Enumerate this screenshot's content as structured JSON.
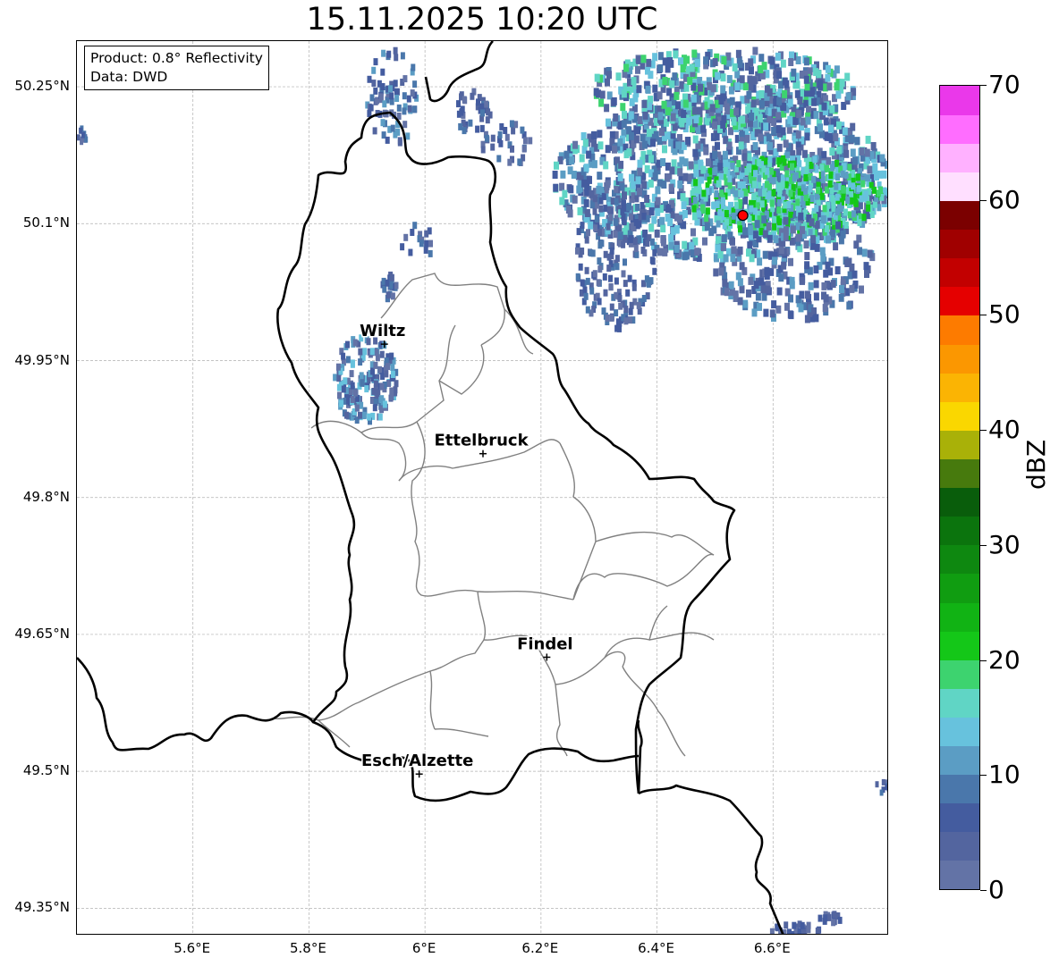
{
  "title": "15.11.2025 10:20 UTC",
  "info": {
    "product": "Product: 0.8° Reflectivity",
    "data_source": "Data: DWD"
  },
  "axes": {
    "lon_range": [
      5.4,
      6.8
    ],
    "lat_range": [
      49.32,
      50.3
    ],
    "x_ticks": [
      {
        "value": 5.6,
        "label": "5.6°E"
      },
      {
        "value": 5.8,
        "label": "5.8°E"
      },
      {
        "value": 6.0,
        "label": "6°E"
      },
      {
        "value": 6.2,
        "label": "6.2°E"
      },
      {
        "value": 6.4,
        "label": "6.4°E"
      },
      {
        "value": 6.6,
        "label": "6.6°E"
      }
    ],
    "y_ticks": [
      {
        "value": 50.25,
        "label": "50.25°N"
      },
      {
        "value": 50.1,
        "label": "50.1°N"
      },
      {
        "value": 49.95,
        "label": "49.95°N"
      },
      {
        "value": 49.8,
        "label": "49.8°N"
      },
      {
        "value": 49.65,
        "label": "49.65°N"
      },
      {
        "value": 49.5,
        "label": "49.5°N"
      },
      {
        "value": 49.35,
        "label": "49.35°N"
      }
    ],
    "gridlines": true
  },
  "cities": [
    {
      "name": "Wiltz",
      "lon": 5.93,
      "lat": 49.968
    },
    {
      "name": "Ettelbruck",
      "lon": 6.1,
      "lat": 49.848
    },
    {
      "name": "Findel",
      "lon": 6.21,
      "lat": 49.625
    },
    {
      "name": "Esch/Alzette",
      "lon": 5.99,
      "lat": 49.497
    }
  ],
  "radar_site": {
    "lon": 6.548,
    "lat": 50.109,
    "color": "#ff0000"
  },
  "colorbar": {
    "label": "dBZ",
    "min": 0,
    "max": 70,
    "ticks": [
      "0",
      "10",
      "20",
      "30",
      "40",
      "50",
      "60",
      "70"
    ],
    "colors": [
      "#6373a6",
      "#53659f",
      "#445c9f",
      "#4a77ab",
      "#5b9dc4",
      "#67c2dd",
      "#60d5c5",
      "#3dd36f",
      "#14c718",
      "#11b314",
      "#109d11",
      "#0e8810",
      "#0b740d",
      "#095d0b",
      "#477a0d",
      "#a9b108",
      "#fad700",
      "#fbb403",
      "#fb9701",
      "#fd7b00",
      "#e50000",
      "#c20000",
      "#a00000",
      "#7b0000",
      "#ffdfff",
      "#ffb1ff",
      "#ff6dff",
      "#ea38ea"
    ]
  },
  "colors": {
    "border": "#000000",
    "cantons": "#808080",
    "grid": "#b0b0b0"
  }
}
